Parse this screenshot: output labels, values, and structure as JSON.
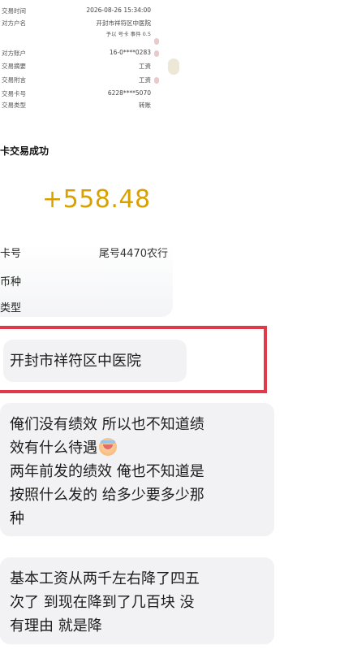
{
  "receipt": {
    "rows": [
      {
        "key": "交易时间",
        "value": "2026-08-26 15:34:00"
      },
      {
        "key": "对方户名",
        "value": "开封市祥符区中医院"
      },
      {
        "key": "对方账户",
        "value": "16-0****0283"
      },
      {
        "key": "交易摘要",
        "value": "工资"
      },
      {
        "key": "交易附言",
        "value": "工资"
      },
      {
        "key": "交易卡号",
        "value": "6228****5070"
      },
      {
        "key": "交易类型",
        "value": "转账"
      }
    ],
    "subline": "予以 号卡 事件 0.5"
  },
  "card": {
    "title": "卡交易成功",
    "amount": "+558.48",
    "rows": [
      {
        "key": "卡号",
        "value": "尾号4470农行"
      },
      {
        "key": "币种",
        "value": ""
      },
      {
        "key": "类型",
        "value": ""
      }
    ]
  },
  "messages": [
    {
      "lines": [
        "开封市祥符区中医院"
      ]
    },
    {
      "lines": [
        "俺们没有绩效 所以也不知道绩",
        "效有什么待遇",
        "两年前发的绩效 俺也不知道是",
        "按照什么发的 给多少要多少那",
        "种"
      ]
    },
    {
      "lines": [
        "基本工资从两千左右降了四五",
        "次了 到现在降到了几百块 没",
        "有理由 就是降"
      ]
    }
  ],
  "colors": {
    "amount": "#d9a100",
    "highlight_border": "#e03a4a",
    "bubble": "#f2f2f4"
  },
  "icons": {
    "emoji": "crying-laughing-emoji"
  }
}
